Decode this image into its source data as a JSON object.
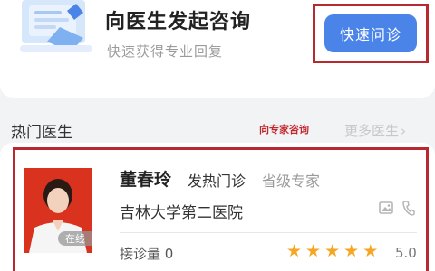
{
  "consult": {
    "title": "向医生发起咨询",
    "subtitle": "快速获得专业回复",
    "quick_button": "快速问诊",
    "illustration_icon": "document-illustration-icon"
  },
  "section": {
    "title": "热门医生",
    "annotation": "向专家咨询",
    "more_label": "更多医生",
    "more_icon": "chevron-right-icon"
  },
  "doctor": {
    "name": "董春玲",
    "department": "发热门诊",
    "level": "省级专家",
    "hospital": "吉林大学第二医院",
    "online_badge": "在线",
    "consult_label": "接诊量 0",
    "rating": "5.0",
    "rating_stars": 5
  },
  "colors": {
    "accent": "#4a84e8",
    "highlight_frame": "#b7292f",
    "star": "#f5a623"
  }
}
